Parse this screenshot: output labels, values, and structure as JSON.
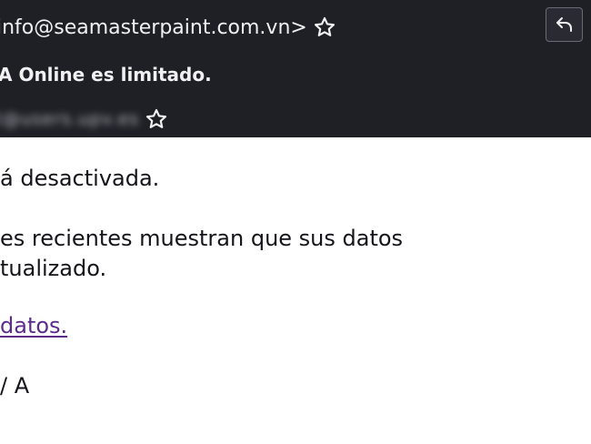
{
  "header": {
    "from": "info@seamasterpaint.com.vn>",
    "subject": "A Online es limitado.",
    "to": "t@users.upv.es"
  },
  "icons": {
    "star": "star-outline-icon",
    "reply": "reply-arrow-icon"
  },
  "colors": {
    "header_bg": "#1f1f26",
    "link": "#5b2c8c"
  },
  "message": {
    "line1": "á desactivada.",
    "line2a": "es recientes muestran que sus datos",
    "line2b": "tualizado.",
    "link_text": " datos.",
    "signature": "/ A"
  }
}
